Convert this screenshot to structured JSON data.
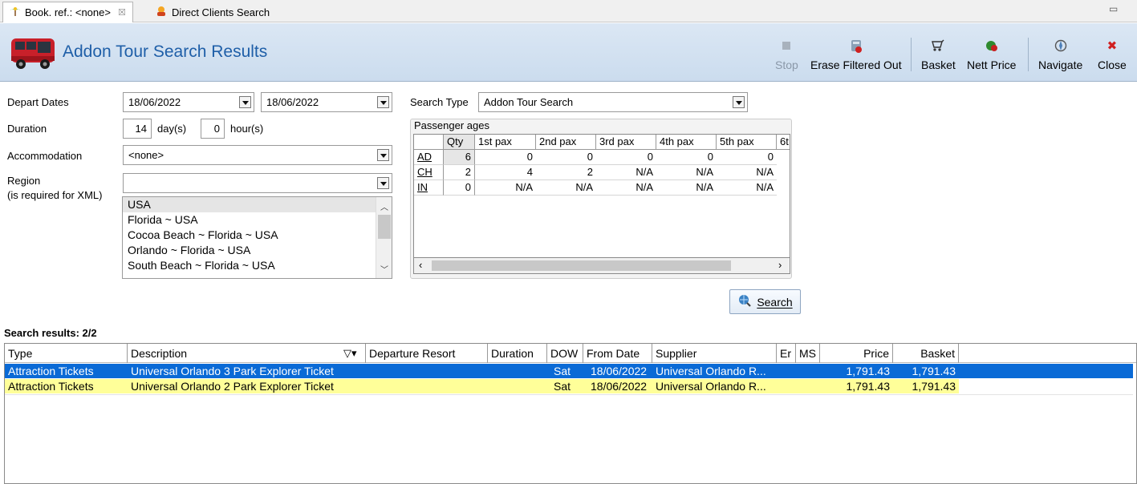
{
  "tabs": [
    {
      "label": "Book. ref.: <none>",
      "icon": "palm-tree-icon",
      "closable": true,
      "active": true
    },
    {
      "label": "Direct Clients Search",
      "icon": "sun-people-icon",
      "closable": false,
      "active": false
    }
  ],
  "header": {
    "title": "Addon Tour Search Results",
    "icon": "bus-icon",
    "toolbar": {
      "stop": "Stop",
      "erase": "Erase Filtered Out",
      "basket": "Basket",
      "nett_price": "Nett Price",
      "navigate": "Navigate",
      "close": "Close"
    }
  },
  "form": {
    "depart_dates_label": "Depart Dates",
    "depart_from": "18/06/2022",
    "depart_to": "18/06/2022",
    "search_type_label": "Search Type",
    "search_type": "Addon Tour Search",
    "duration_label": "Duration",
    "duration_days": "14",
    "days_unit": "day(s)",
    "duration_hours": "0",
    "hours_unit": "hour(s)",
    "accommodation_label": "Accommodation",
    "accommodation": "<none>",
    "region_label": "Region",
    "region_note": "(is required for XML)",
    "region_value": "",
    "region_list": [
      "USA",
      "Florida ~ USA",
      "Cocoa Beach ~ Florida ~ USA",
      "Orlando ~ Florida ~ USA",
      "South Beach ~ Florida ~ USA"
    ],
    "region_selected": "USA",
    "search_button": "Search"
  },
  "passenger_ages": {
    "label": "Passenger ages",
    "columns": [
      "Qty",
      "1st pax",
      "2nd pax",
      "3rd pax",
      "4th pax",
      "5th pax",
      "6t"
    ],
    "rows": [
      {
        "type": "AD",
        "values": [
          "6",
          "0",
          "0",
          "0",
          "0",
          "0"
        ]
      },
      {
        "type": "CH",
        "values": [
          "2",
          "4",
          "2",
          "N/A",
          "N/A",
          "N/A"
        ]
      },
      {
        "type": "IN",
        "values": [
          "0",
          "N/A",
          "N/A",
          "N/A",
          "N/A",
          "N/A"
        ]
      }
    ]
  },
  "results": {
    "label": "Search results: 2/2",
    "columns": [
      "Type",
      "Description",
      "Departure Resort",
      "Duration",
      "DOW",
      "From Date",
      "Supplier",
      "Er",
      "MS",
      "Price",
      "Basket"
    ],
    "rows": [
      {
        "type": "Attraction Tickets",
        "description": "Universal Orlando 3 Park Explorer Ticket",
        "departure_resort": "",
        "duration": "",
        "dow": "Sat",
        "from_date": "18/06/2022",
        "supplier": "Universal Orlando R...",
        "er": "",
        "ms": "",
        "price": "1,791.43",
        "basket": "1,791.43",
        "state": "selected"
      },
      {
        "type": "Attraction Tickets",
        "description": "Universal Orlando 2 Park Explorer Ticket",
        "departure_resort": "",
        "duration": "",
        "dow": "Sat",
        "from_date": "18/06/2022",
        "supplier": "Universal Orlando R...",
        "er": "",
        "ms": "",
        "price": "1,791.43",
        "basket": "1,791.43",
        "state": "highlighted"
      }
    ]
  },
  "colors": {
    "selected_row": "#0a6ad6",
    "highlighted_row": "#ffff99",
    "title": "#1f5fa8",
    "header_bg": "#d3e2f2"
  }
}
